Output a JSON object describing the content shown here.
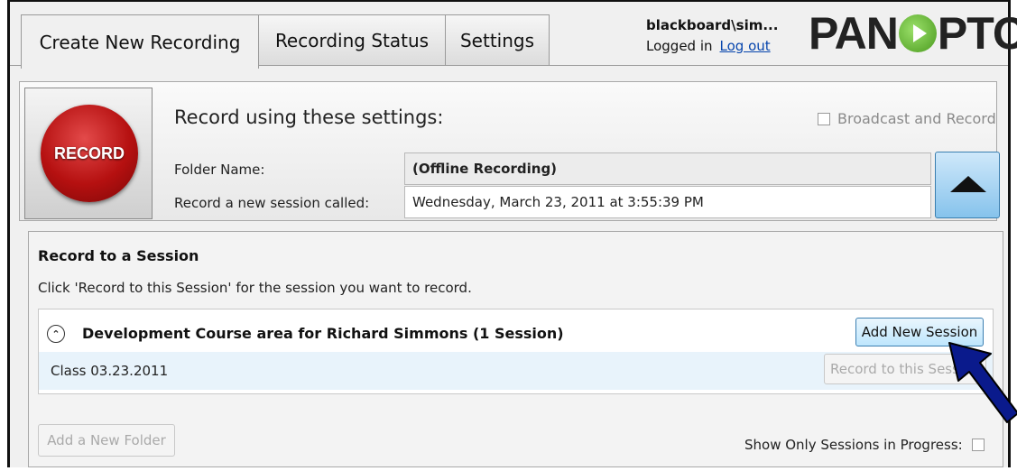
{
  "tabs": [
    {
      "label": "Create New Recording"
    },
    {
      "label": "Recording Status"
    },
    {
      "label": "Settings"
    }
  ],
  "user": {
    "name": "blackboard\\sim...",
    "logged_in_text": "Logged in",
    "logout_label": "Log out"
  },
  "logo": {
    "before": "PAN",
    "after": "PTO"
  },
  "record": {
    "button_label": "RECORD",
    "heading": "Record using these settings:",
    "broadcast_label": "Broadcast and Record",
    "folder_label": "Folder Name:",
    "folder_value": "(Offline Recording)",
    "session_label": "Record a new session called:",
    "session_value": "Wednesday, March 23, 2011 at 3:55:39 PM"
  },
  "sessions": {
    "title": "Record to a Session",
    "instruction": "Click 'Record to this Session' for the session you want to record.",
    "group_title": "Development Course area for Richard Simmons (1 Session)",
    "add_session_label": "Add New Session",
    "items": [
      {
        "name": "Class 03.23.2011",
        "record_label": "Record to this Session"
      }
    ],
    "add_folder_label": "Add a New Folder",
    "show_only_label": "Show Only Sessions in Progress:"
  },
  "colors": {
    "record_red": "#b51010",
    "accent_blue": "#86c3ec",
    "arrow_navy": "#0a1a8c"
  }
}
